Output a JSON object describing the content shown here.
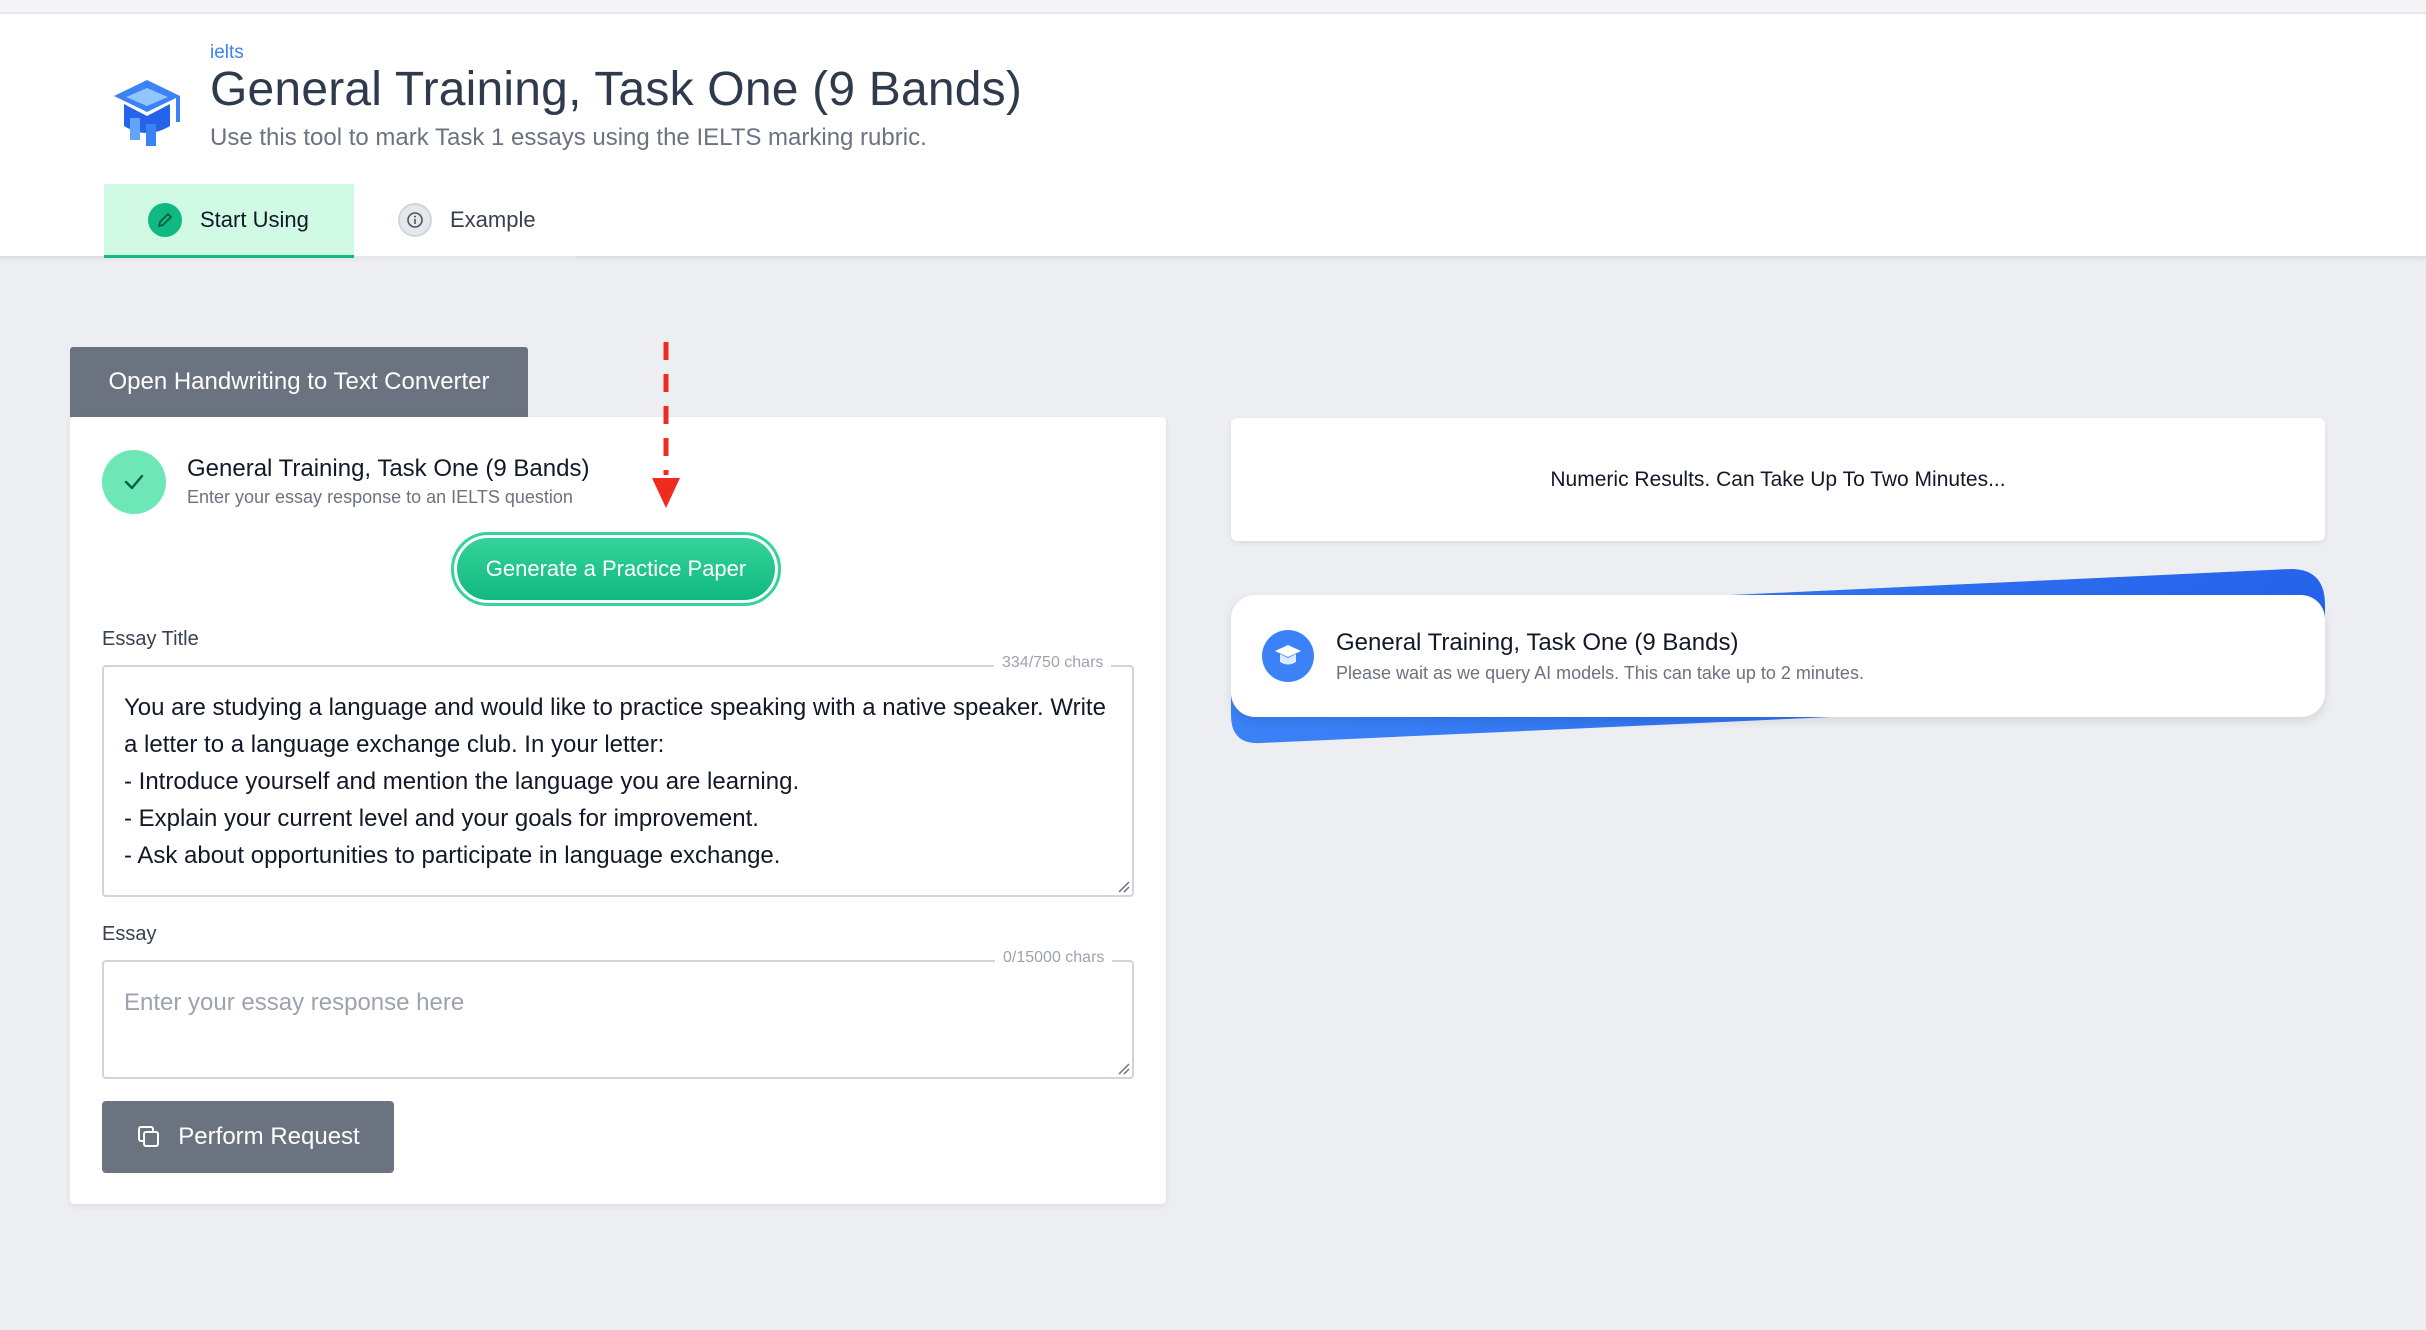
{
  "header": {
    "eyebrow": "ielts",
    "title": "General Training, Task One (9 Bands)",
    "subtitle": "Use this tool to mark Task 1 essays using the IELTS marking rubric.",
    "logo_icon": "graduation-cap-icon"
  },
  "tabs": [
    {
      "label": "Start Using",
      "icon": "pencil-icon",
      "active": true
    },
    {
      "label": "Example",
      "icon": "info-icon",
      "active": false
    }
  ],
  "handwriting_button": "Open Handwriting to Text Converter",
  "form": {
    "title": "General Training, Task One (9 Bands)",
    "subtitle": "Enter your essay response to an IELTS question",
    "generate_button": "Generate a Practice Paper",
    "essay_title": {
      "label": "Essay Title",
      "counter": "334/750 chars",
      "lines": [
        "You are studying a language and would like to practice speaking with a native speaker. Write",
        "a letter to a language exchange club. In your letter:",
        "- Introduce yourself and mention the language you are learning.",
        "- Explain your current level and your goals for improvement.",
        "- Ask about opportunities to participate in language exchange."
      ]
    },
    "essay": {
      "label": "Essay",
      "counter": "0/15000 chars",
      "value": "",
      "placeholder": "Enter your essay response here"
    },
    "perform_button": "Perform Request"
  },
  "results": {
    "numeric_text": "Numeric Results. Can Take Up To Two Minutes...",
    "loader_title": "General Training, Task One (9 Bands)",
    "loader_subtitle": "Please wait as we query AI models. This can take up to 2 minutes."
  },
  "colors": {
    "accent_green": "#10b981",
    "accent_blue": "#3b82f6",
    "button_gray": "#6b7280",
    "annotation_red": "#ef2b1f"
  }
}
